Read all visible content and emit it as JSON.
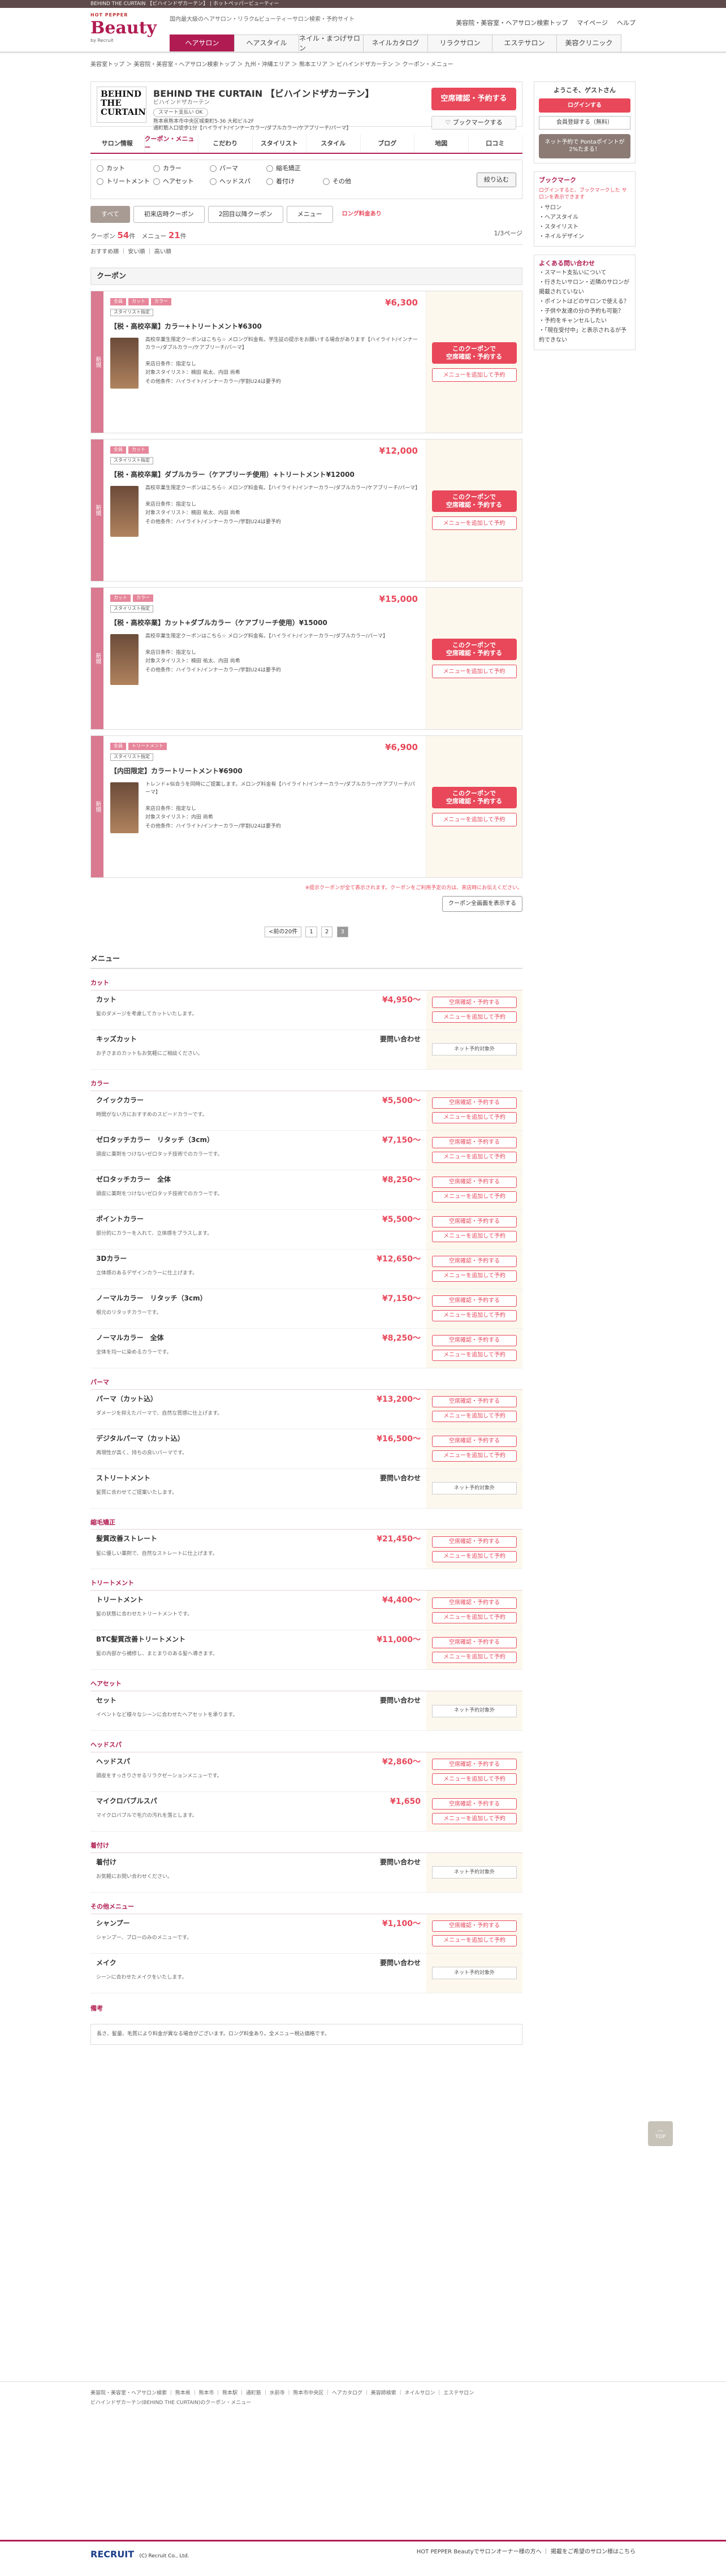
{
  "topline": "BEHIND THE CURTAIN 【ビハインドザカーテン】 | ホットペッパービューティー",
  "header": {
    "brand_top": "HOT PEPPER",
    "brand": "Beauty",
    "brand_by": "by Recruit",
    "desc": "国内最大級のヘアサロン・リラク&ビューティーサロン検索・予約サイト",
    "links": [
      "美容院・美容室・ヘアサロン検索トップ",
      "マイページ",
      "ヘルプ"
    ]
  },
  "gnav": [
    "ヘアサロン",
    "ヘアスタイル",
    "ネイル・まつげサロン",
    "ネイルカタログ",
    "リラクサロン",
    "エステサロン",
    "美容クリニック"
  ],
  "breadcrumb": "美容室トップ ＞ 美容院・美容室・ヘアサロン検索トップ ＞ 九州・沖縄エリア ＞ 熊本エリア ＞ ビハインドザカーテン ＞ クーポン・メニュー",
  "salon": {
    "logo_lines": [
      "BEHIND",
      "THE",
      "CURTAIN"
    ],
    "name": "BEHIND THE CURTAIN 【ビハインドザカーテン】",
    "kana": "ビハインドザカーテン",
    "badge": "スマート支払い OK",
    "address": "熊本県熊本市中央区城東町5-36 大和ビル2F",
    "access": "通町筋入口徒歩1分【ハイライト/インナーカラー/ダブルカラー/ケアブリーチ/パーマ】",
    "book_btn": "空席確認・予約する",
    "bookmark_btn": "ブックマークする"
  },
  "salon_tabs": [
    "サロン情報",
    "クーポン・メニュー",
    "こだわり",
    "スタイリスト",
    "スタイル",
    "ブログ",
    "地図",
    "口コミ"
  ],
  "filters": [
    "カット",
    "カラー",
    "パーマ",
    "縮毛矯正",
    "トリートメント",
    "ヘアセット",
    "ヘッドスパ",
    "着付け",
    "その他"
  ],
  "filter_btn": "絞り込む",
  "coupon_tabs": [
    "すべて",
    "初来店時クーポン",
    "2回目以降クーポン",
    "メニュー"
  ],
  "coupon_note": "ロング料金あり",
  "counts": {
    "label_coupon": "クーポン",
    "coupon": "54",
    "label_menu": "メニュー",
    "menu": "21",
    "unit": "件",
    "page": "1/3ページ"
  },
  "sort": "おすすめ順 ｜ 安い順 ｜ 高い順",
  "coupon_section": "クーポン",
  "coupons": [
    {
      "bar": "新規",
      "tags": [
        "全員",
        "カット",
        "カラー"
      ],
      "staff": "スタイリスト指定",
      "name": "【税・高校卒業】カラー+トリートメント¥6300",
      "price": "¥6,300",
      "desc": "高校卒業生限定クーポンはこちら☆ メロング料金有。学生証の提示をお願いする場合があります【ハイライト/インナーカラー/ダブルカラー/ケアブリーチ/パーマ】",
      "cond1": "来店日条件：指定なし",
      "cond2": "対象スタイリスト：楠田 祐太、内田 尚希",
      "cond3": "その他条件：ハイライト/インナーカラー/学割U24は要予約"
    },
    {
      "bar": "新規",
      "tags": [
        "全員",
        "カット"
      ],
      "staff": "スタイリスト指定",
      "name": "【税・高校卒業】ダブルカラー（ケアブリーチ使用）+トリートメント¥12000",
      "price": "¥12,000",
      "desc": "高校卒業生限定クーポンはこちら☆ メロング料金有。【ハイライト/インナーカラー/ダブルカラー/ケアブリーチ/パーマ】",
      "cond1": "来店日条件：指定なし",
      "cond2": "対象スタイリスト：楠田 祐太、内田 尚希",
      "cond3": "その他条件：ハイライト/インナーカラー/学割U24は要予約"
    },
    {
      "bar": "新規",
      "tags": [
        "カット",
        "カラー"
      ],
      "staff": "スタイリスト指定",
      "name": "【税・高校卒業】カット+ダブルカラー（ケアブリーチ使用）¥15000",
      "price": "¥15,000",
      "desc": "高校卒業生限定クーポンはこちら☆ メロング料金有。【ハイライト/インナーカラー/ダブルカラー/パーマ】",
      "cond1": "来店日条件：指定なし",
      "cond2": "対象スタイリスト：楠田 祐太、内田 尚希",
      "cond3": "その他条件：ハイライト/インナーカラー/学割U24は要予約"
    },
    {
      "bar": "新規",
      "tags": [
        "全員",
        "トリートメント"
      ],
      "staff": "スタイリスト指定",
      "name": "【内田限定】カラートリートメント¥6900",
      "price": "¥6,900",
      "desc": "トレンド+似合うを同時にご提案します。メロング料金有【ハイライト/インナーカラー/ダブルカラー/ケアブリーチ/パーマ】",
      "cond1": "来店日条件：指定なし",
      "cond2": "対象スタイリスト：内田 尚希",
      "cond3": "その他条件：ハイライト/インナーカラー/学割U24は要予約"
    }
  ],
  "coupon_note_bottom": "※提示クーポンが全て表示されます。クーポンをご利用予定の方は、来店時にお伝えください。",
  "coupon_see": "クーポン全画面を表示する",
  "pager": [
    "<前の20件",
    "1",
    "2",
    "3"
  ],
  "menu_title": "メニュー",
  "book_btn": "空席確認・予約する",
  "add_btn": "メニューを追加して予約",
  "tel_btn": "ネット予約対象外",
  "menus": [
    {
      "cat": "カット",
      "items": [
        {
          "name": "カット",
          "price": "¥4,950～",
          "desc": "髪のダメージを考慮してカットいたします。",
          "act": "book"
        },
        {
          "name": "キッズカット",
          "price": "要問い合わせ",
          "desc": "お子さまのカットもお気軽にご相談ください。",
          "act": "tel"
        }
      ]
    },
    {
      "cat": "カラー",
      "items": [
        {
          "name": "クイックカラー",
          "price": "¥5,500～",
          "desc": "時間がない方におすすめのスピードカラーです。",
          "act": "book"
        },
        {
          "name": "ゼロタッチカラー　リタッチ（3cm）",
          "price": "¥7,150～",
          "desc": "頭皮に薬剤をつけないゼロタッチ技術でのカラーです。",
          "act": "book"
        },
        {
          "name": "ゼロタッチカラー　全体",
          "price": "¥8,250～",
          "desc": "頭皮に薬剤をつけないゼロタッチ技術でのカラーです。",
          "act": "book"
        },
        {
          "name": "ポイントカラー",
          "price": "¥5,500～",
          "desc": "部分的にカラーを入れて、立体感をプラスします。",
          "act": "book"
        },
        {
          "name": "3Dカラー",
          "price": "¥12,650～",
          "desc": "立体感のあるデザインカラーに仕上げます。",
          "act": "book"
        },
        {
          "name": "ノーマルカラー　リタッチ（3cm）",
          "price": "¥7,150～",
          "desc": "根元のリタッチカラーです。",
          "act": "book"
        },
        {
          "name": "ノーマルカラー　全体",
          "price": "¥8,250～",
          "desc": "全体を均一に染めるカラーです。",
          "act": "book"
        }
      ]
    },
    {
      "cat": "パーマ",
      "items": [
        {
          "name": "パーマ（カット込）",
          "price": "¥13,200～",
          "desc": "ダメージを抑えたパーマで、自然な質感に仕上げます。",
          "act": "book"
        },
        {
          "name": "デジタルパーマ（カット込）",
          "price": "¥16,500～",
          "desc": "再現性が高く、持ちの良いパーマです。",
          "act": "book"
        },
        {
          "name": "ストリートメント",
          "price": "要問い合わせ",
          "desc": "髪質に合わせてご提案いたします。",
          "act": "tel"
        }
      ]
    },
    {
      "cat": "縮毛矯正",
      "items": [
        {
          "name": "髪質改善ストレート",
          "price": "¥21,450～",
          "desc": "髪に優しい薬剤で、自然なストレートに仕上げます。",
          "act": "book"
        }
      ]
    },
    {
      "cat": "トリートメント",
      "items": [
        {
          "name": "トリートメント",
          "price": "¥4,400～",
          "desc": "髪の状態に合わせたトリートメントです。",
          "act": "book"
        },
        {
          "name": "BTC髪質改善トリートメント",
          "price": "¥11,000～",
          "desc": "髪の内部から補修し、まとまりのある髪へ導きます。",
          "act": "book"
        }
      ]
    },
    {
      "cat": "ヘアセット",
      "items": [
        {
          "name": "セット",
          "price": "要問い合わせ",
          "desc": "イベントなど様々なシーンに合わせたヘアセットを承ります。",
          "act": "tel"
        }
      ]
    },
    {
      "cat": "ヘッドスパ",
      "items": [
        {
          "name": "ヘッドスパ",
          "price": "¥2,860～",
          "desc": "頭皮をすっきりさせるリラクゼーションメニューです。",
          "act": "book"
        },
        {
          "name": "マイクロバブルスパ",
          "price": "¥1,650",
          "desc": "マイクロバブルで毛穴の汚れを落とします。",
          "act": "book"
        }
      ]
    },
    {
      "cat": "着付け",
      "items": [
        {
          "name": "着付け",
          "price": "要問い合わせ",
          "desc": "お気軽にお問い合わせください。",
          "act": "tel"
        }
      ]
    },
    {
      "cat": "その他メニュー",
      "items": [
        {
          "name": "シャンプー",
          "price": "¥1,100～",
          "desc": "シャンプー、ブローのみのメニューです。",
          "act": "book"
        },
        {
          "name": "メイク",
          "price": "要問い合わせ",
          "desc": "シーンに合わせたメイクをいたします。",
          "act": "tel"
        }
      ]
    }
  ],
  "remarks_title": "備考",
  "remarks": "長さ、髪量、毛質により料金が異なる場合がございます。ロング料金あり。全メニュー税込価格です。",
  "side": {
    "welcome": "ようこそ、ゲストさん",
    "login": "ログインする",
    "register": "会員登録する（無料）",
    "points": "ネット予約で Pontaポイントが 2%たまる！",
    "bm_title": "ブックマーク",
    "bm_note": "ログインすると、ブックマークした サロンを表示できます",
    "recent": [
      "サロン",
      "ヘアスタイル",
      "スタイリスト",
      "ネイルデザイン"
    ],
    "faq_title": "よくある問い合わせ",
    "faq": [
      "スマート支払いについて",
      "行きたいサロン・近隣のサロンが掲載されていない",
      "ポイントはどのサロンで使える？",
      "子供や友達の分の予約も可能？",
      "予約をキャンセルしたい",
      "「現在受付中」と表示されるが予約できない"
    ]
  },
  "totop": "TOP",
  "footer": {
    "links": "美容院・美容室・ヘアサロン検索 ｜ 熊本県 ｜ 熊本市 ｜ 熊本駅 ｜ 通町筋 ｜ 水前寺 ｜ 熊本市中央区 ｜ ヘアカタログ ｜ 美容師検索 ｜ ネイルサロン ｜ エステサロン",
    "title": "ビハインドザカーテン(BEHIND THE CURTAIN)のクーポン・メニュー",
    "brand": "RECRUIT",
    "copy": "(C) Recruit Co., Ltd.",
    "right": "HOT PEPPER Beautyでサロンオーナー様の方へ ｜ 掲載をご希望のサロン様はこちら"
  }
}
